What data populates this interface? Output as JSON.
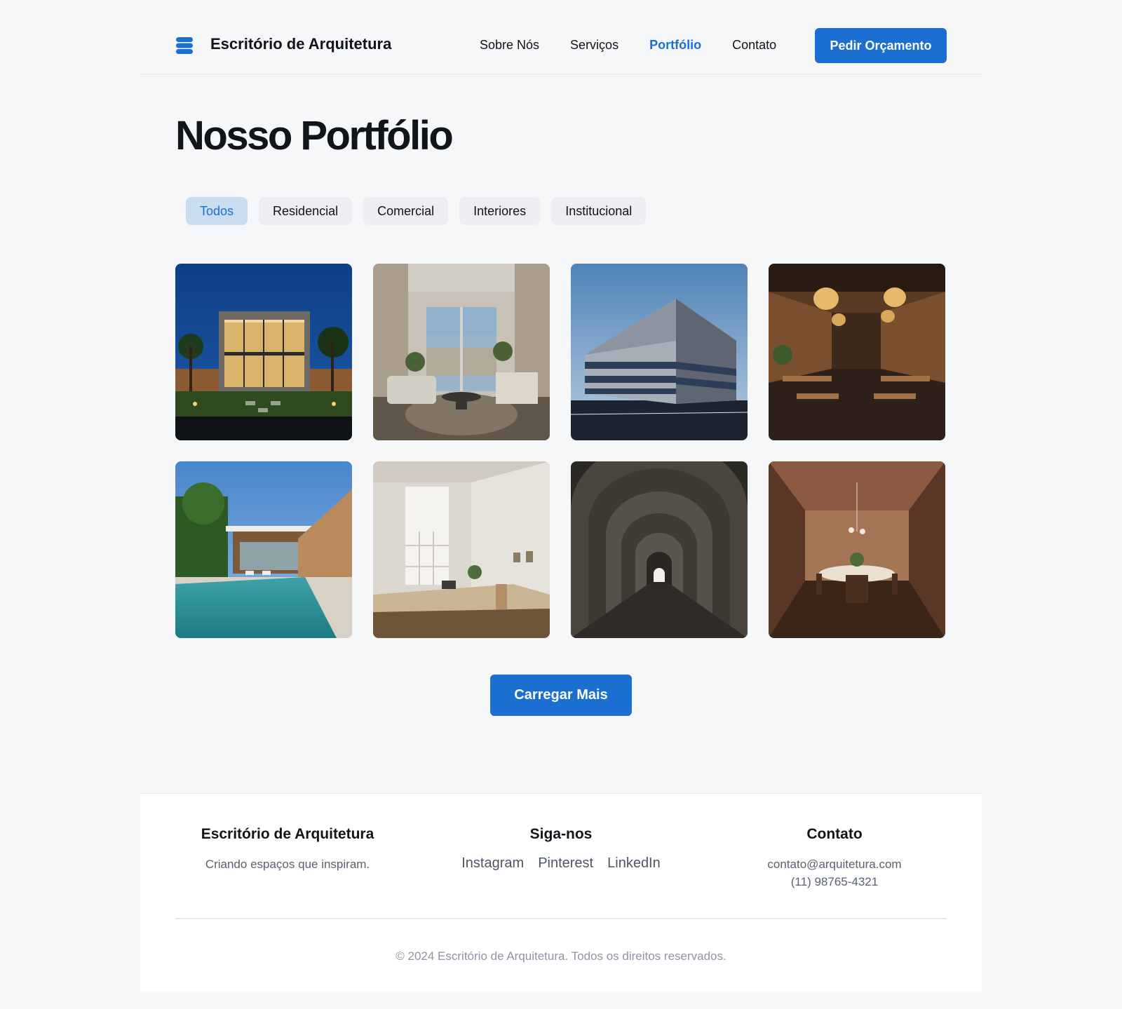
{
  "header": {
    "brand": "Escritório de Arquitetura",
    "logo_icon": "stack-icon",
    "nav": [
      "Sobre Nós",
      "Serviços",
      "Portfólio",
      "Contato"
    ],
    "active_nav": "Portfólio",
    "cta_label": "Pedir Orçamento"
  },
  "main": {
    "title": "Nosso Portfólio",
    "filters": [
      "Todos",
      "Residencial",
      "Comercial",
      "Interiores",
      "Institucional"
    ],
    "active_filter": "Todos",
    "projects": [
      {
        "image": "modern-house-night"
      },
      {
        "image": "living-room-interior"
      },
      {
        "image": "commercial-building"
      },
      {
        "image": "restaurant-interior"
      },
      {
        "image": "house-with-pool"
      },
      {
        "image": "minimal-office-interior"
      },
      {
        "image": "arched-corridor"
      },
      {
        "image": "wood-dining-room"
      }
    ],
    "load_more_label": "Carregar Mais"
  },
  "footer": {
    "brand_title": "Escritório de Arquitetura",
    "brand_tagline": "Criando espaços que inspiram.",
    "social_title": "Siga-nos",
    "social_links": [
      "Instagram",
      "Pinterest",
      "LinkedIn"
    ],
    "contact_title": "Contato",
    "email": "contato@arquitetura.com",
    "phone": "(11) 98765-4321",
    "copyright": "© 2024 Escritório de Arquitetura. Todos os direitos reservados."
  },
  "colors": {
    "accent": "#1a6fd1",
    "background": "#f6f7f9",
    "active_filter_bg": "#c9dcf0"
  }
}
